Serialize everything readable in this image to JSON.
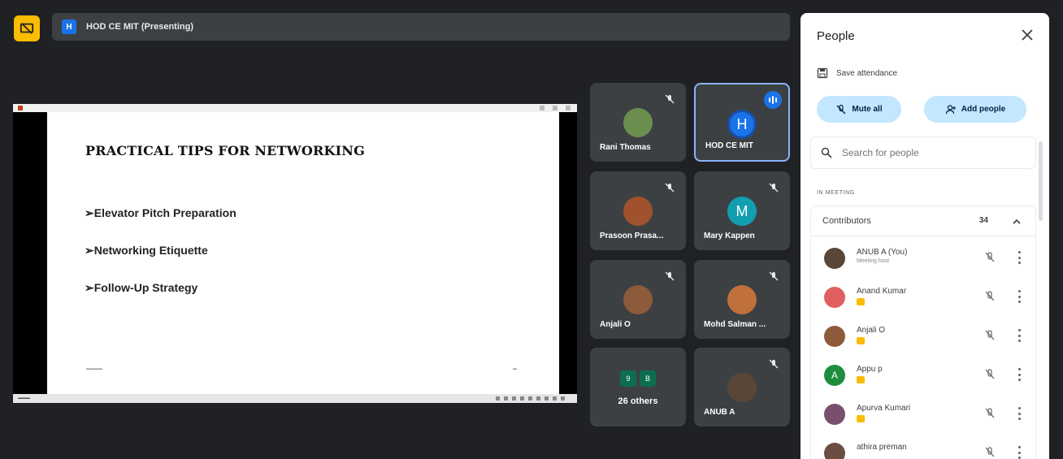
{
  "presenting_bar": {
    "avatar_letter": "H",
    "label": "HOD CE MIT (Presenting)"
  },
  "slide": {
    "title": "PRACTICAL TIPS FOR NETWORKING",
    "bullets": [
      "➢Elevator Pitch Preparation",
      "➢Networking Etiquette",
      "➢Follow-Up Strategy"
    ]
  },
  "tiles": [
    {
      "name": "Rani Thomas",
      "avatar_color": "#6b8e4e",
      "muted": true
    },
    {
      "name": "HOD CE MIT",
      "avatar_letter": "H",
      "avatar_color": "#1a73e8",
      "speaking": true
    },
    {
      "name": "Prasoon Prasa...",
      "avatar_color": "#a0522d",
      "muted": true
    },
    {
      "name": "Mary Kappen",
      "avatar_letter": "M",
      "avatar_color": "#129eaf",
      "muted": true
    },
    {
      "name": "Anjali O",
      "avatar_color": "#8d5a3b",
      "muted": true
    },
    {
      "name": "Mohd Salman ...",
      "avatar_color": "#c0703a",
      "muted": true
    },
    {
      "name": "26 others",
      "others_avatars": [
        "9",
        "B"
      ]
    },
    {
      "name": "ANUB A",
      "avatar_color": "#5a4636",
      "muted": true
    }
  ],
  "people": {
    "title": "People",
    "save_attendance": "Save attendance",
    "mute_all": "Mute all",
    "add_people": "Add people",
    "search_placeholder": "Search for people",
    "section": "IN MEETING",
    "contributors_label": "Contributors",
    "contributors_count": "34",
    "list": [
      {
        "name": "ANUB A (You)",
        "sub": "Meeting host",
        "avatar_color": "#5a4636"
      },
      {
        "name": "Anand Kumar",
        "avatar_color": "#e06060"
      },
      {
        "name": "Anjali O",
        "avatar_color": "#8d5a3b"
      },
      {
        "name": "Appu p",
        "avatar_letter": "A",
        "avatar_color": "#1e8e3e"
      },
      {
        "name": "Apurva Kumari",
        "avatar_color": "#7a4f6e"
      },
      {
        "name": "athira preman",
        "avatar_color": "#6d4c41"
      }
    ]
  },
  "colors": {
    "accent": "#1a73e8",
    "pill_bg": "#c2e7ff",
    "present_icon": "#fbbc04",
    "tile_bg": "#3c4043",
    "bg": "#202124"
  }
}
